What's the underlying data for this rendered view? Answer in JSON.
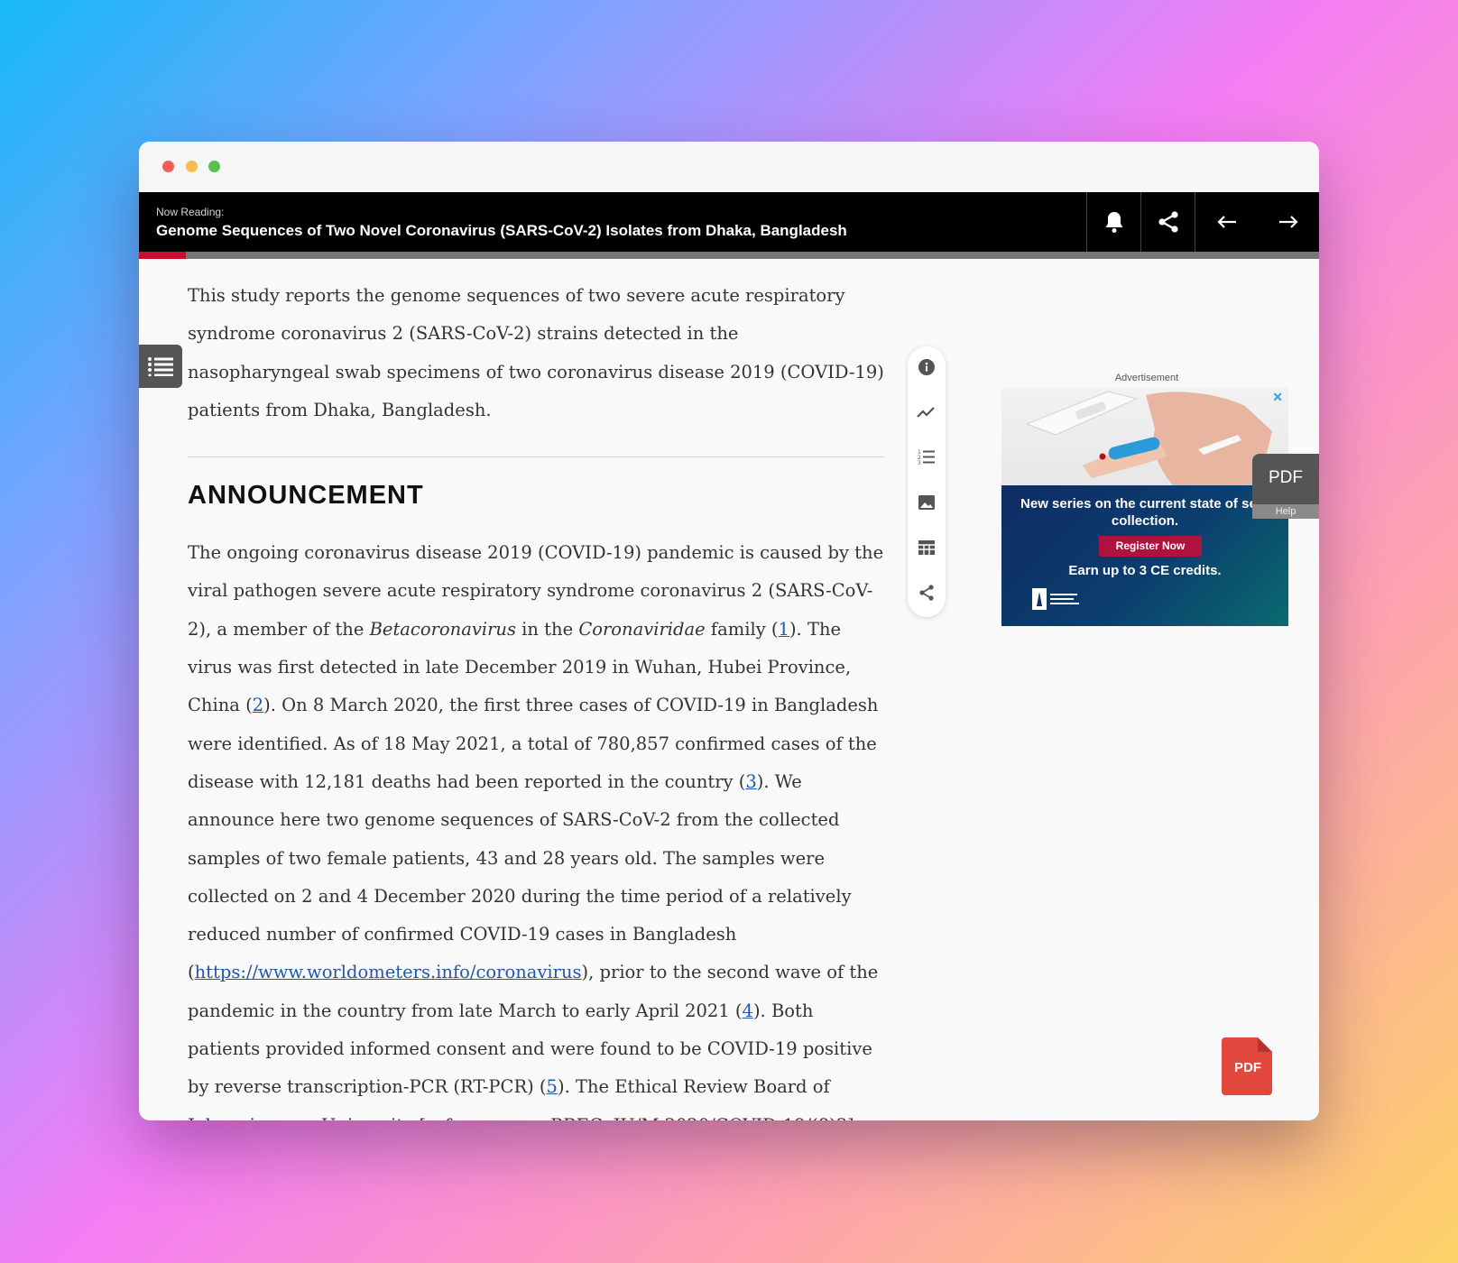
{
  "reader": {
    "now_reading_label": "Now Reading:",
    "title": "Genome Sequences of Two Novel Coronavirus (SARS-CoV-2) Isolates from Dhaka, Bangladesh",
    "buttons": [
      "bell-icon",
      "share-icon",
      "arrow-left-icon",
      "arrow-right-icon"
    ],
    "progress_fraction": 0.04,
    "accent_color": "#c8102e"
  },
  "article": {
    "abstract": "This study reports the genome sequences of two severe acute respiratory syndrome coronavirus 2 (SARS-CoV-2) strains detected in the nasopharyngeal swab specimens of two coronavirus disease 2019 (COVID-19) patients from Dhaka, Bangladesh.",
    "heading": "ANNOUNCEMENT",
    "body": {
      "p1_text1": "The ongoing coronavirus disease 2019 (COVID-19) pandemic is caused by the viral pathogen severe acute respiratory syndrome coronavirus 2 (SARS-CoV-2), a member of the ",
      "p1_italic1": "Betacoronavirus",
      "p1_text2": " in the ",
      "p1_italic2": "Coronaviridae",
      "p1_text3": " family (",
      "ref1": "1",
      "p1_text4": "). The virus was first detected in late December 2019 in Wuhan, Hubei Province, China (",
      "ref2": "2",
      "p1_text5": "). On 8 March 2020, the first three cases of COVID-19 in Bangladesh were identified. As of 18 May 2021, a total of 780,857 confirmed cases of the disease with 12,181 deaths had been reported in the country (",
      "ref3": "3",
      "p1_text6": "). We announce here two genome sequences of SARS-CoV-2 from the collected samples of two female patients, 43 and 28 years old. The samples were collected on 2 and 4 December 2020 during the time period of a relatively reduced number of confirmed COVID-19 cases in Bangladesh (",
      "link": "https://www.worldometers.info/coronavirus",
      "p1_text7": "), prior to the second wave of the pandemic in the country from late March to early April 2021 (",
      "ref4": "4",
      "p1_text8": "). Both patients provided informed consent and were found to be COVID-19 positive by reverse transcription-PCR (RT-PCR) (",
      "ref5": "5",
      "p1_text9": "). The Ethical Review Board of Jahangirnagar University [reference no. BBEC, JU/M 2020/COVID-19/(8)3] approved all the"
    }
  },
  "side_tools": [
    "info-icon",
    "trend-icon",
    "numbered-list-icon",
    "image-icon",
    "table-icon",
    "share-icon"
  ],
  "advertisement": {
    "label": "Advertisement",
    "close": "✕",
    "headline": "New series on the current state of self-collection.",
    "button": "Register Now",
    "credits": "Earn up to 3 CE credits."
  },
  "pdf_tab": {
    "label": "PDF",
    "help": "Help"
  },
  "pdf_fab": {
    "label": "PDF",
    "color": "#e2483d"
  }
}
